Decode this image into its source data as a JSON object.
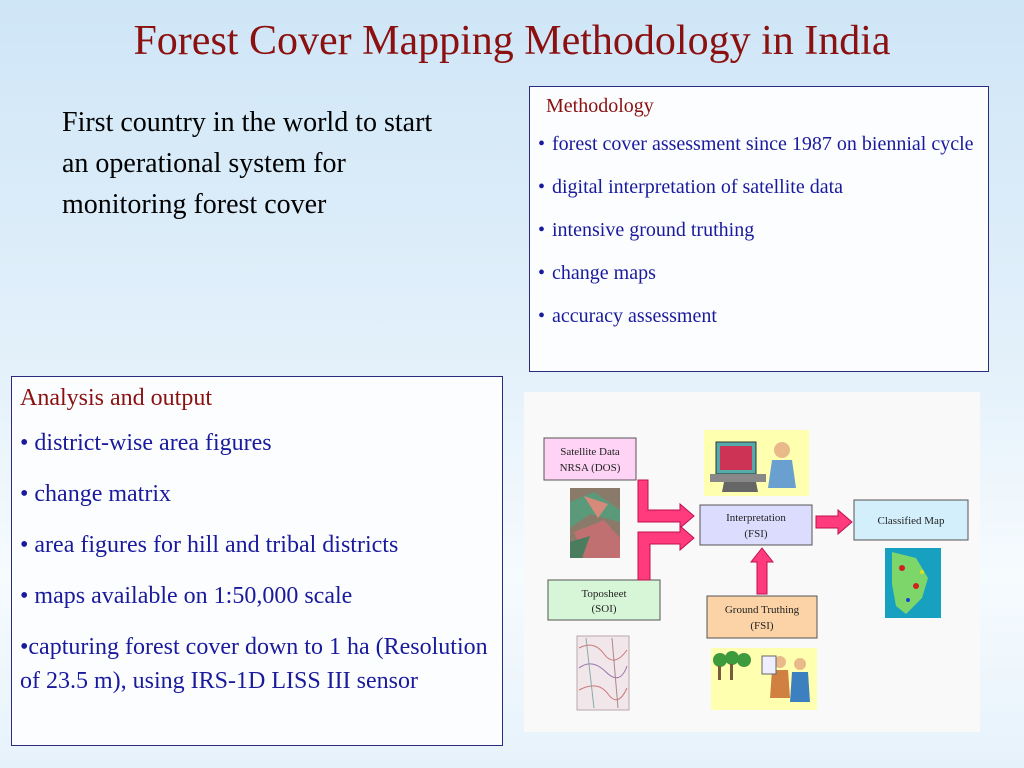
{
  "title": "Forest Cover Mapping Methodology in India",
  "intro": "First country in the world to start an operational system for monitoring forest cover",
  "methodology": {
    "heading": "Methodology",
    "items": [
      "forest cover assessment since 1987 on biennial cycle",
      "digital interpretation of satellite data",
      "intensive ground truthing",
      "change maps",
      "accuracy assessment"
    ]
  },
  "analysis": {
    "heading": "Analysis and output",
    "items": [
      "• district-wise area figures",
      "• change matrix",
      "• area figures for hill and tribal districts",
      "• maps available on 1:50,000 scale",
      "•capturing forest cover down to 1 ha (Resolution of 23.5 m), using IRS-1D LISS III  sensor"
    ]
  },
  "flowchart": {
    "satellite": {
      "line1": "Satellite Data",
      "line2": "NRSA (DOS)"
    },
    "toposheet": {
      "line1": "Toposheet",
      "line2": "(SOI)"
    },
    "interpretation": {
      "line1": "Interpretation",
      "line2": "(FSI)"
    },
    "ground": {
      "line1": "Ground Truthing",
      "line2": "(FSI)"
    },
    "classified": {
      "line1": "Classified Map"
    }
  },
  "colors": {
    "title": "#8b1010",
    "bullet_text": "#1a1a9c",
    "arrow": "#ff3a7d",
    "satellite_box": "#ffd3f5",
    "toposheet_box": "#d7f6d7",
    "interpretation_box": "#dcdcff",
    "ground_box": "#fcd3a6",
    "classified_box": "#d3effb"
  }
}
